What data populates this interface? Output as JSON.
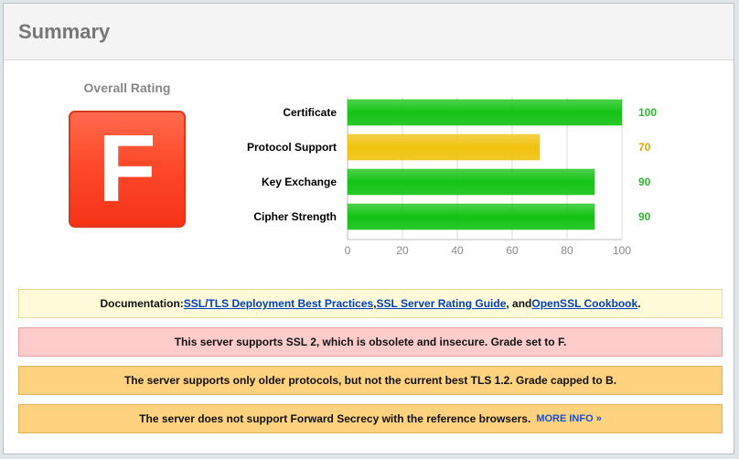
{
  "header": {
    "title": "Summary"
  },
  "overall": {
    "label": "Overall Rating",
    "grade": "F"
  },
  "chart_data": {
    "type": "bar",
    "orientation": "horizontal",
    "categories": [
      "Certificate",
      "Protocol Support",
      "Key Exchange",
      "Cipher Strength"
    ],
    "values": [
      100,
      70,
      90,
      90
    ],
    "colors": [
      "#13c313",
      "#f0c30e",
      "#13c313",
      "#13c313"
    ],
    "value_label_colors": [
      "#2fb72f",
      "#f0a000",
      "#2fb72f",
      "#2fb72f"
    ],
    "xlim": [
      0,
      100
    ],
    "xticks": [
      0,
      20,
      40,
      60,
      80,
      100
    ],
    "grid": true
  },
  "notices": {
    "doc": {
      "prefix": "Documentation: ",
      "link1": "SSL/TLS Deployment Best Practices",
      "sep1": ", ",
      "link2": "SSL Server Rating Guide",
      "sep2": ", and ",
      "link3": "OpenSSL Cookbook",
      "suffix": "."
    },
    "error": "This server supports SSL 2, which is obsolete and insecure. Grade set to F.",
    "warn1": "The server supports only older protocols, but not the current best TLS 1.2. Grade capped to B.",
    "warn2": "The server does not support Forward Secrecy with the reference browsers.",
    "warn2_link": "MORE INFO »"
  }
}
